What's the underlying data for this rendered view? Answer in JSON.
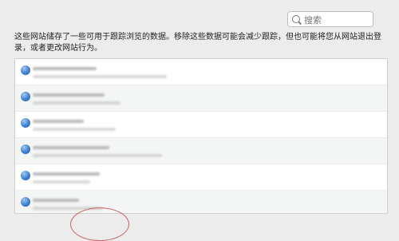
{
  "search": {
    "placeholder": "搜索"
  },
  "info": {
    "text": "这些网站储存了一些可用于跟踪浏览的数据。移除这些数据可能会减少跟踪，但也可能将您从网站退出登录，或者更改网站行为。"
  },
  "website_data": {
    "items": [
      {
        "name": "",
        "detail": ""
      },
      {
        "name": "",
        "detail": ""
      },
      {
        "name": "",
        "detail": ""
      },
      {
        "name": "",
        "detail": ""
      },
      {
        "name": "",
        "detail": ""
      },
      {
        "name": "",
        "detail": ""
      }
    ]
  },
  "colors": {
    "window_bg": "#ececec",
    "globe": "#3d7fd1"
  }
}
